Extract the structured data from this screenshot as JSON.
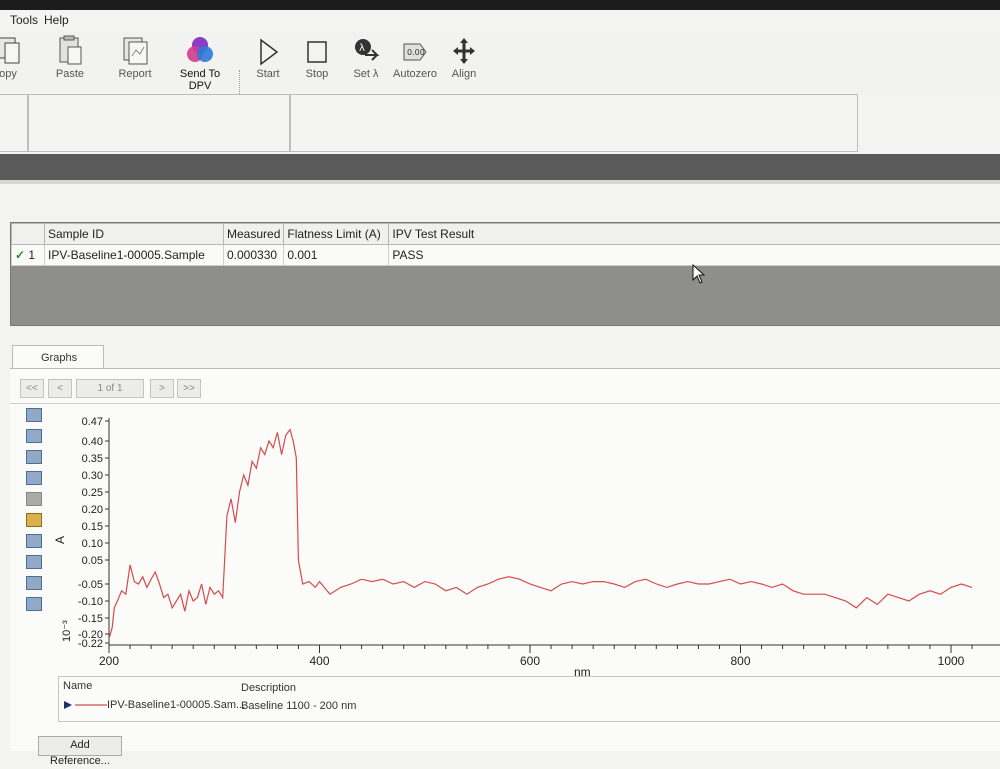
{
  "menu": {
    "tools": "Tools",
    "help": "Help"
  },
  "toolbar": {
    "copy": "opy",
    "paste": "Paste",
    "report": "Report",
    "send_to_dpv": "Send To DPV",
    "start": "Start",
    "stop": "Stop",
    "set_lambda": "Set λ",
    "autozero": "Autozero",
    "align": "Align",
    "autozero_icon_text": "0.00"
  },
  "results_table": {
    "headers": [
      "",
      "Sample ID",
      "Measured",
      "Flatness Limit (A)",
      "IPV Test Result"
    ],
    "row": {
      "check": "✓",
      "index": "1",
      "sample_id": "IPV-Baseline1-00005.Sample",
      "measured": "0.000330",
      "flatness_limit": "0.001",
      "result": "PASS"
    }
  },
  "graphs": {
    "tab_label": "Graphs",
    "nav": {
      "first": "<<",
      "prev": "<",
      "page": "1 of 1",
      "next": ">",
      "last": ">>"
    }
  },
  "legend": {
    "name_header": "Name",
    "description_header": "Description",
    "name": "IPV-Baseline1-00005.Sam...",
    "description": "Baseline 1100 - 200 nm"
  },
  "add_reference": "Add Reference...",
  "chart_data": {
    "type": "line",
    "xlabel": "nm",
    "ylabel": "A",
    "yscale_label": "10⁻³",
    "xlim": [
      200,
      1020
    ],
    "ylim": [
      -0.22,
      0.47
    ],
    "xticks": [
      "200",
      "400",
      "600",
      "800",
      "1000"
    ],
    "yticks": [
      "0.47",
      "0.40",
      "0.35",
      "0.30",
      "0.25",
      "0.20",
      "0.15",
      "0.10",
      "0.05",
      "-0.05",
      "-0.10",
      "-0.15",
      "-0.20",
      "-0.22"
    ],
    "series_color": "#d64b4b",
    "series": [
      {
        "name": "IPV-Baseline1-00005.Sample",
        "x": [
          200,
          203,
          205,
          208,
          212,
          216,
          220,
          224,
          228,
          232,
          236,
          240,
          244,
          248,
          252,
          256,
          260,
          264,
          268,
          272,
          276,
          280,
          284,
          288,
          292,
          296,
          300,
          304,
          308,
          312,
          316,
          320,
          324,
          328,
          332,
          336,
          340,
          344,
          348,
          352,
          356,
          360,
          364,
          368,
          372,
          375,
          378,
          380,
          384,
          390,
          396,
          400,
          410,
          420,
          430,
          440,
          450,
          460,
          470,
          480,
          490,
          500,
          510,
          520,
          530,
          540,
          550,
          560,
          570,
          580,
          590,
          600,
          610,
          620,
          630,
          640,
          650,
          660,
          670,
          680,
          690,
          700,
          710,
          720,
          730,
          740,
          750,
          760,
          770,
          780,
          790,
          800,
          810,
          820,
          830,
          840,
          850,
          860,
          870,
          880,
          890,
          900,
          910,
          920,
          930,
          940,
          950,
          960,
          970,
          980,
          990,
          1000,
          1010,
          1020
        ],
        "y": [
          -0.21,
          -0.18,
          -0.12,
          -0.1,
          -0.07,
          -0.08,
          0.03,
          -0.04,
          -0.05,
          -0.02,
          -0.06,
          -0.03,
          0.0,
          -0.05,
          -0.09,
          -0.08,
          -0.12,
          -0.1,
          -0.08,
          -0.13,
          -0.07,
          -0.1,
          -0.09,
          -0.05,
          -0.11,
          -0.06,
          -0.08,
          -0.07,
          -0.09,
          0.18,
          0.23,
          0.16,
          0.25,
          0.3,
          0.27,
          0.34,
          0.32,
          0.38,
          0.36,
          0.4,
          0.38,
          0.43,
          0.36,
          0.42,
          0.44,
          0.4,
          0.35,
          0.05,
          -0.05,
          -0.04,
          -0.06,
          -0.04,
          -0.08,
          -0.06,
          -0.05,
          -0.03,
          -0.04,
          -0.03,
          -0.05,
          -0.04,
          -0.06,
          -0.04,
          -0.05,
          -0.07,
          -0.06,
          -0.08,
          -0.06,
          -0.05,
          -0.03,
          -0.02,
          -0.03,
          -0.05,
          -0.06,
          -0.07,
          -0.05,
          -0.04,
          -0.05,
          -0.04,
          -0.04,
          -0.05,
          -0.06,
          -0.04,
          -0.03,
          -0.05,
          -0.06,
          -0.05,
          -0.04,
          -0.05,
          -0.05,
          -0.04,
          -0.03,
          -0.05,
          -0.04,
          -0.05,
          -0.06,
          -0.05,
          -0.07,
          -0.08,
          -0.08,
          -0.08,
          -0.09,
          -0.1,
          -0.12,
          -0.09,
          -0.11,
          -0.08,
          -0.09,
          -0.1,
          -0.08,
          -0.07,
          -0.08,
          -0.06,
          -0.05,
          -0.06
        ]
      }
    ],
    "grid": false,
    "legend_position": "bottom"
  }
}
